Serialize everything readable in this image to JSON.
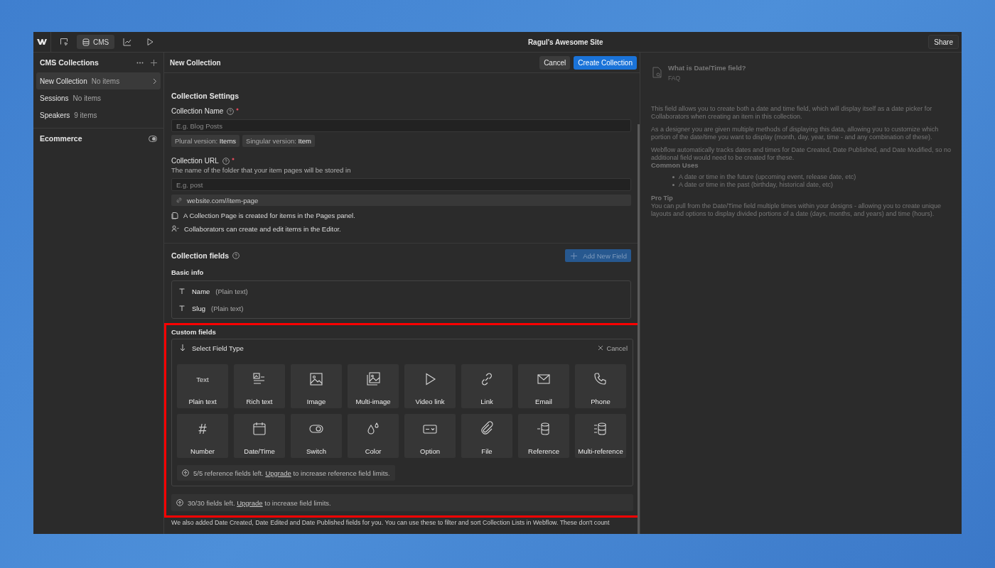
{
  "topbar": {
    "tabs": [
      {
        "kind": "cursor",
        "selected": false
      },
      {
        "kind": "database",
        "label": "CMS",
        "selected": true
      },
      {
        "kind": "chart",
        "selected": false
      },
      {
        "kind": "play",
        "selected": false
      }
    ],
    "title": "Ragul's Awesome Site",
    "share": "Share"
  },
  "sidebar": {
    "title": "CMS Collections",
    "items": [
      {
        "name": "New Collection",
        "count": "No items",
        "selected": true
      },
      {
        "name": "Sessions",
        "count": "No items",
        "selected": false
      },
      {
        "name": "Speakers",
        "count": "9 items",
        "selected": false
      }
    ],
    "ecommerce": "Ecommerce"
  },
  "editor": {
    "title": "New Collection",
    "cancel": "Cancel",
    "create": "Create Collection",
    "settings_title": "Collection Settings",
    "name_label": "Collection Name",
    "name_placeholder": "E.g. Blog Posts",
    "chips": [
      {
        "label": "Plural version:",
        "value": "Items"
      },
      {
        "label": "Singular version:",
        "value": "Item"
      }
    ],
    "url_label": "Collection URL",
    "url_help": "The name of the folder that your item pages will be stored in",
    "url_placeholder": "E.g. post",
    "url_preview": "website.com//item-page",
    "notes": [
      {
        "kind": "page",
        "text": "A Collection Page is created for items in the Pages panel."
      },
      {
        "kind": "people",
        "text": "Collaborators can create and edit items in the Editor."
      }
    ],
    "fields_title": "Collection fields",
    "add_field": "Add New Field",
    "basic_title": "Basic info",
    "basic_fields": [
      {
        "name": "Name",
        "type": "(Plain text)"
      },
      {
        "name": "Slug",
        "type": "(Plain text)"
      }
    ],
    "custom_title": "Custom fields",
    "select_title": "Select Field Type",
    "select_cancel": "Cancel",
    "field_types": [
      {
        "kind": "text",
        "icon_text": "Text",
        "label": "Plain text"
      },
      {
        "kind": "rich",
        "label": "Rich text"
      },
      {
        "kind": "image",
        "label": "Image"
      },
      {
        "kind": "multiimage",
        "label": "Multi-image"
      },
      {
        "kind": "video",
        "label": "Video link"
      },
      {
        "kind": "link",
        "label": "Link"
      },
      {
        "kind": "email",
        "label": "Email"
      },
      {
        "kind": "phone",
        "label": "Phone"
      },
      {
        "kind": "number",
        "icon_text": "#",
        "label": "Number"
      },
      {
        "kind": "date",
        "label": "Date/Time"
      },
      {
        "kind": "switch",
        "label": "Switch"
      },
      {
        "kind": "color",
        "label": "Color"
      },
      {
        "kind": "option",
        "label": "Option"
      },
      {
        "kind": "file",
        "label": "File"
      },
      {
        "kind": "reference",
        "label": "Reference"
      },
      {
        "kind": "multiref",
        "label": "Multi-reference"
      }
    ],
    "ref_limit": {
      "before": "5/5 reference fields left.",
      "link": "Upgrade",
      "after": "to increase reference field limits."
    },
    "field_limit": {
      "before": "30/30 fields left.",
      "link": "Upgrade",
      "after": "to increase field limits."
    },
    "footer": "We also added Date Created, Date Edited and Date Published fields for you. You can use these to filter and sort Collection Lists in Webflow. These don't count"
  },
  "help": {
    "title": "What is Date/Time field?",
    "subtitle": "FAQ",
    "paragraphs": [
      "This field allows you to create both a date and time field, which will display itself as a date picker for Collaborators when creating an item in this collection.",
      "As a designer you are given multiple methods of displaying this data, allowing you to customize which portion of the date/time you want to display (month, day, year, time - and any combination of these).",
      "Webflow automatically tracks dates and times for Date Created, Date Published, and Date Modified, so no additional field would need to be created for these."
    ],
    "uses_title": "Common Uses",
    "uses": [
      "A date or time in the future (upcoming event, release date, etc)",
      "A date or time in the past (birthday, historical date, etc)"
    ],
    "tip_title": "Pro Tip",
    "tip": "You can pull from the Date/Time field multiple times within your designs - allowing you to create unique layouts and options to display divided portions of a date (days, months, and years) and time (hours)."
  }
}
